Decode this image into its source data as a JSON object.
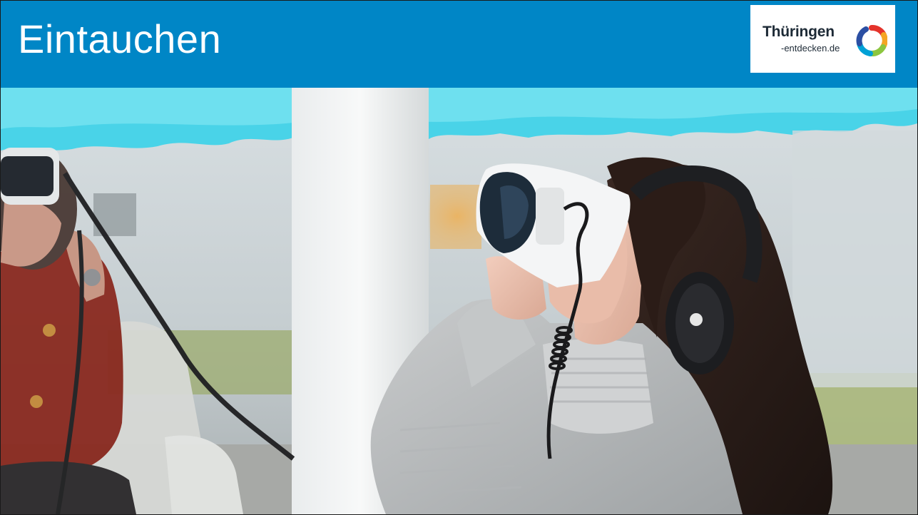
{
  "slide": {
    "title": "Eintauchen",
    "accent_color": "#0086c6"
  },
  "logo": {
    "line1": "Thüringen",
    "line2": "-entdecken.de",
    "mark_icon": "multicolor-ring-icon"
  },
  "photo": {
    "icon": "vr-headset-photo"
  }
}
